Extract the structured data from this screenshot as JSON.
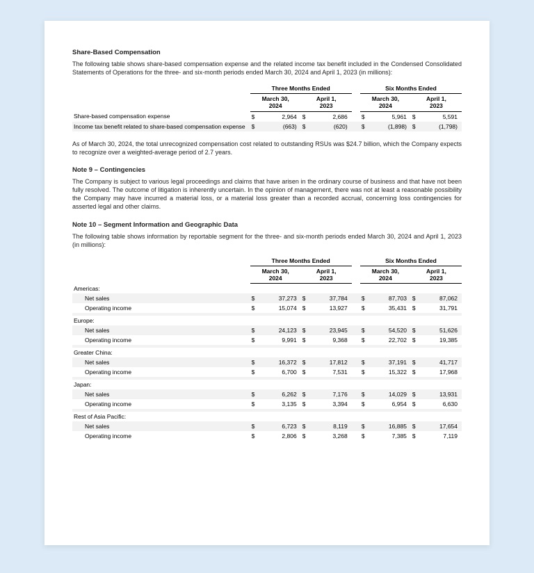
{
  "sbc": {
    "title": "Share-Based Compensation",
    "intro": "The following table shows share-based compensation expense and the related income tax benefit included in the Condensed Consolidated Statements of Operations for the three- and six-month periods ended March 30, 2024 and April 1, 2023 (in millions):",
    "period_headers": [
      "Three Months Ended",
      "Six Months Ended"
    ],
    "date_headers": {
      "m3": {
        "a": "March 30,",
        "b": "2024"
      },
      "a1": {
        "a": "April 1,",
        "b": "2023"
      }
    },
    "rows": [
      {
        "label": "Share-based compensation expense",
        "vals": [
          "2,964",
          "2,686",
          "5,961",
          "5,591"
        ],
        "shade": false
      },
      {
        "label": "Income tax benefit related to share-based compensation expense",
        "vals": [
          "(663)",
          "(620)",
          "(1,898)",
          "(1,798)"
        ],
        "shade": true
      }
    ],
    "followup": "As of March 30, 2024, the total unrecognized compensation cost related to outstanding RSUs was $24.7 billion, which the Company expects to recognize over a weighted-average period of 2.7 years."
  },
  "note9": {
    "title": "Note 9 – Contingencies",
    "body": "The Company is subject to various legal proceedings and claims that have arisen in the ordinary course of business and that have not been fully resolved. The outcome of litigation is inherently uncertain. In the opinion of management, there was not at least a reasonable possibility the Company may have incurred a material loss, or a material loss greater than a recorded accrual, concerning loss contingencies for asserted legal and other claims."
  },
  "note10": {
    "title": "Note 10 – Segment Information and Geographic Data",
    "intro": "The following table shows information by reportable segment for the three- and six-month periods ended March 30, 2024 and April 1, 2023 (in millions):",
    "segments": [
      {
        "name": "Americas:",
        "net_sales": [
          "37,273",
          "37,784",
          "87,703",
          "87,062"
        ],
        "op_income": [
          "15,074",
          "13,927",
          "35,431",
          "31,791"
        ]
      },
      {
        "name": "Europe:",
        "net_sales": [
          "24,123",
          "23,945",
          "54,520",
          "51,626"
        ],
        "op_income": [
          "9,991",
          "9,368",
          "22,702",
          "19,385"
        ]
      },
      {
        "name": "Greater China:",
        "net_sales": [
          "16,372",
          "17,812",
          "37,191",
          "41,717"
        ],
        "op_income": [
          "6,700",
          "7,531",
          "15,322",
          "17,968"
        ]
      },
      {
        "name": "Japan:",
        "net_sales": [
          "6,262",
          "7,176",
          "14,029",
          "13,931"
        ],
        "op_income": [
          "3,135",
          "3,394",
          "6,954",
          "6,630"
        ]
      },
      {
        "name": "Rest of Asia Pacific:",
        "net_sales": [
          "6,723",
          "8,119",
          "16,885",
          "17,654"
        ],
        "op_income": [
          "2,806",
          "3,268",
          "7,385",
          "7,119"
        ]
      }
    ],
    "row_labels": {
      "net_sales": "Net sales",
      "op_income": "Operating income"
    }
  },
  "curr": "$"
}
